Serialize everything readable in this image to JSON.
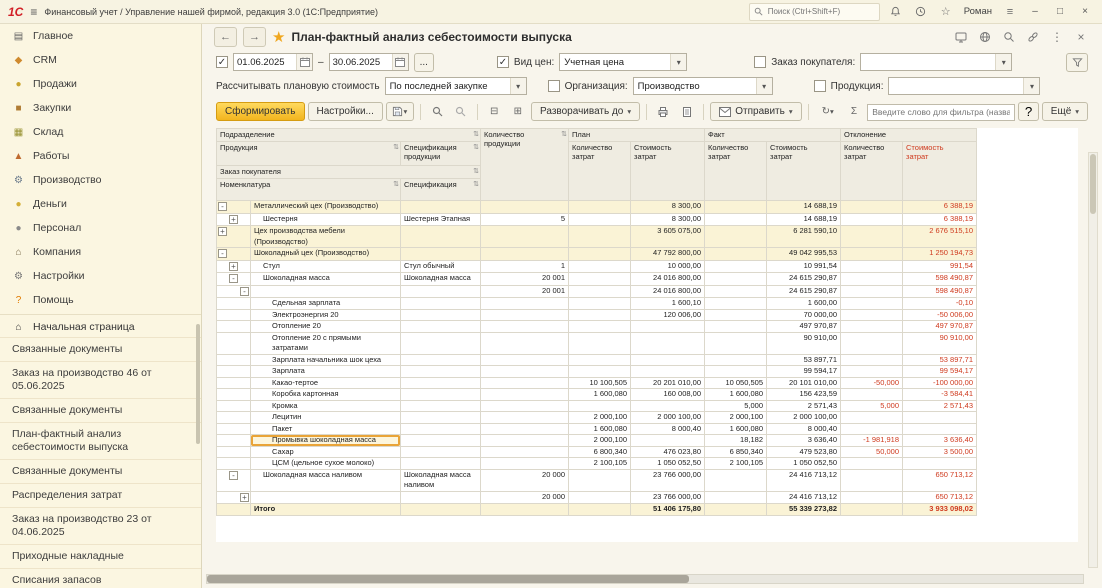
{
  "titlebar": {
    "logo": "1С",
    "app_title": "Финансовый учет / Управление нашей фирмой, редакция 3.0 (1С:Предприятие)",
    "search_placeholder": "Поиск (Ctrl+Shift+F)",
    "user_name": "Роман"
  },
  "sidebar": {
    "sections": [
      {
        "icon": "main-icon",
        "label": "Главное"
      },
      {
        "icon": "crm-icon",
        "label": "CRM"
      },
      {
        "icon": "sales-icon",
        "label": "Продажи"
      },
      {
        "icon": "purchases-icon",
        "label": "Закупки"
      },
      {
        "icon": "warehouse-icon",
        "label": "Склад"
      },
      {
        "icon": "works-icon",
        "label": "Работы"
      },
      {
        "icon": "production-icon",
        "label": "Производство"
      },
      {
        "icon": "money-icon",
        "label": "Деньги"
      },
      {
        "icon": "personnel-icon",
        "label": "Персонал"
      },
      {
        "icon": "company-icon",
        "label": "Компания"
      },
      {
        "icon": "settings-icon",
        "label": "Настройки"
      },
      {
        "icon": "help-icon",
        "label": "Помощь"
      }
    ],
    "home_label": "Начальная страница",
    "history": [
      "Связанные документы",
      "Заказ на производство 46 от 05.06.2025",
      "Связанные документы",
      "План-фактный анализ себестоимости выпуска",
      "Связанные документы",
      "Распределения затрат",
      "Заказ на производство 23 от 04.06.2025",
      "Приходные накладные",
      "Списания запасов"
    ]
  },
  "report": {
    "title": "План-фактный анализ себестоимости выпуска",
    "period_from": "01.06.2025",
    "period_to": "30.06.2025",
    "period_separator": "–",
    "period_more_label": "...",
    "price_type_label": "Вид цен:",
    "price_type_value": "Учетная цена",
    "customer_order_label": "Заказ покупателя:",
    "customer_order_value": "",
    "plan_cost_label": "Рассчитывать плановую стоимость",
    "plan_cost_value": "По последней закупке",
    "organization_label": "Организация:",
    "organization_value": "Производство",
    "product_label": "Продукция:",
    "product_value": "",
    "generate_label": "Сформировать",
    "settings_label": "Настройки...",
    "expand_label": "Разворачивать до",
    "send_label": "Отправить",
    "filter_placeholder": "Введите слово для фильтра (название т",
    "help_label": "?",
    "more_label": "Ещё"
  },
  "table": {
    "headers": {
      "department": "Подразделение",
      "product": "Продукция",
      "product_spec": "Спецификация продукции",
      "customer_order": "Заказ покупателя",
      "nomenclature": "Номенклатура",
      "spec": "Спецификация",
      "qty_product": "Количество продукции",
      "plan": "План",
      "fact": "Факт",
      "deviation": "Отклонение",
      "qty_cost": "Количество затрат",
      "cost": "Стоимость затрат"
    },
    "rows": [
      {
        "t": "g",
        "lvl": 0,
        "exp": "-",
        "name": "Металлический цех (Производство)",
        "pc": "8 300,00",
        "fc": "14 688,19",
        "dc": "6 388,19"
      },
      {
        "t": "p",
        "lvl": 1,
        "exp": "+",
        "name": "Шестерня",
        "spec": "Шестерня Этапная",
        "qty": "5",
        "pc": "8 300,00",
        "fc": "14 688,19",
        "dc": "6 388,19"
      },
      {
        "t": "g",
        "lvl": 0,
        "exp": "+",
        "name": "Цех производства мебели (Производство)",
        "pc": "3 605 075,00",
        "fc": "6 281 590,10",
        "dc": "2 676 515,10"
      },
      {
        "t": "g",
        "lvl": 0,
        "exp": "-",
        "name": "Шоколадный цех (Производство)",
        "pc": "47 792 800,00",
        "fc": "49 042 995,53",
        "dc": "1 250 194,73"
      },
      {
        "t": "p",
        "lvl": 1,
        "exp": "+",
        "name": "Стул",
        "spec": "Стул обычный",
        "qty": "1",
        "pc": "10 000,00",
        "fc": "10 991,54",
        "dc": "991,54"
      },
      {
        "t": "p",
        "lvl": 1,
        "exp": "-",
        "name": "Шоколадная масса",
        "spec": "Шоколадная масса",
        "qty": "20 001",
        "pc": "24 016 800,00",
        "fc": "24 615 290,87",
        "dc": "598 490,87"
      },
      {
        "t": "q",
        "lvl": 2,
        "exp": "-",
        "qty": "20 001",
        "pc": "24 016 800,00",
        "fc": "24 615 290,87",
        "dc": "598 490,87"
      },
      {
        "t": "i",
        "name": "Сдельная зарплата",
        "pc": "1 600,10",
        "fc": "1 600,00",
        "dc": "-0,10"
      },
      {
        "t": "i",
        "name": "Электроэнергия 20",
        "pc": "120 006,00",
        "fc": "70 000,00",
        "dc": "-50 006,00"
      },
      {
        "t": "i",
        "name": "Отопление 20",
        "fc": "497 970,87",
        "dc": "497 970,87"
      },
      {
        "t": "i",
        "name": "Отопление 20 с прямыми затратами",
        "fc": "90 910,00",
        "dc": "90 910,00"
      },
      {
        "t": "i",
        "name": "Зарплата начальника шок цеха",
        "fc": "53 897,71",
        "dc": "53 897,71"
      },
      {
        "t": "i",
        "name": "Зарплата",
        "fc": "99 594,17",
        "dc": "99 594,17"
      },
      {
        "t": "i",
        "name": "Какао-тертое",
        "pq": "10 100,505",
        "pc": "20 201 010,00",
        "fq": "10 050,505",
        "fc": "20 101 010,00",
        "dq": "-50,000",
        "dc": "-100 000,00"
      },
      {
        "t": "i",
        "name": "Коробка картонная",
        "pq": "1 600,080",
        "pc": "160 008,00",
        "fq": "1 600,080",
        "fc": "156 423,59",
        "dc": "-3 584,41"
      },
      {
        "t": "i",
        "name": "Кромка",
        "fq": "5,000",
        "fc": "2 571,43",
        "dq": "5,000",
        "dc": "2 571,43"
      },
      {
        "t": "i",
        "name": "Лецитин",
        "pq": "2 000,100",
        "pc": "2 000 100,00",
        "fq": "2 000,100",
        "fc": "2 000 100,00"
      },
      {
        "t": "i",
        "name": "Пакет",
        "pq": "1 600,080",
        "pc": "8 000,40",
        "fq": "1 600,080",
        "fc": "8 000,40"
      },
      {
        "t": "i",
        "name": "Промывка шоколадная масса",
        "pq": "2 000,100",
        "fq": "18,182",
        "fc": "3 636,40",
        "dq": "-1 981,918",
        "dc": "3 636,40",
        "hl": true
      },
      {
        "t": "i",
        "name": "Сахар",
        "pq": "6 800,340",
        "pc": "476 023,80",
        "fq": "6 850,340",
        "fc": "479 523,80",
        "dq": "50,000",
        "dc": "3 500,00"
      },
      {
        "t": "i",
        "name": "ЦСМ (цельное сухое молоко)",
        "pq": "2 100,105",
        "pc": "1 050 052,50",
        "fq": "2 100,105",
        "fc": "1 050 052,50"
      },
      {
        "t": "p",
        "lvl": 1,
        "exp": "-",
        "name": "Шоколадная масса наливом",
        "spec": "Шоколадная масса наливом",
        "qty": "20 000",
        "pc": "23 766 000,00",
        "fc": "24 416 713,12",
        "dc": "650 713,12"
      },
      {
        "t": "q",
        "lvl": 2,
        "exp": "+",
        "qty": "20 000",
        "pc": "23 766 000,00",
        "fc": "24 416 713,12",
        "dc": "650 713,12"
      },
      {
        "t": "total",
        "name": "Итого",
        "pc": "51 406 175,80",
        "fc": "55 339 273,82",
        "dc": "3 933 098,02"
      }
    ]
  },
  "colors": {
    "accent_yellow": "#f2b51e",
    "deviation_red": "#cf3a1e",
    "sidebar_bg": "#fbf6e1",
    "group_row_bg": "#faf3d6",
    "highlight_border": "#e9a438"
  }
}
